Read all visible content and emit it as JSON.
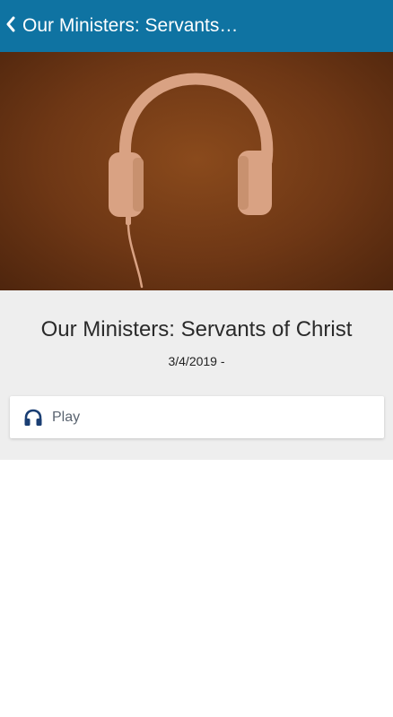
{
  "header": {
    "title": "Our Ministers: Servants…",
    "back_icon": "chevron-left-icon",
    "background_color": "#0f73a2"
  },
  "hero": {
    "icon": "headphones-icon",
    "background_color": "#6e3715",
    "icon_color": "#d9a283"
  },
  "sermon": {
    "title": "Our Ministers: Servants of Christ",
    "date": "3/4/2019 -"
  },
  "actions": {
    "play_label": "Play",
    "play_icon": "headphones-icon",
    "icon_color": "#1a3e73"
  }
}
